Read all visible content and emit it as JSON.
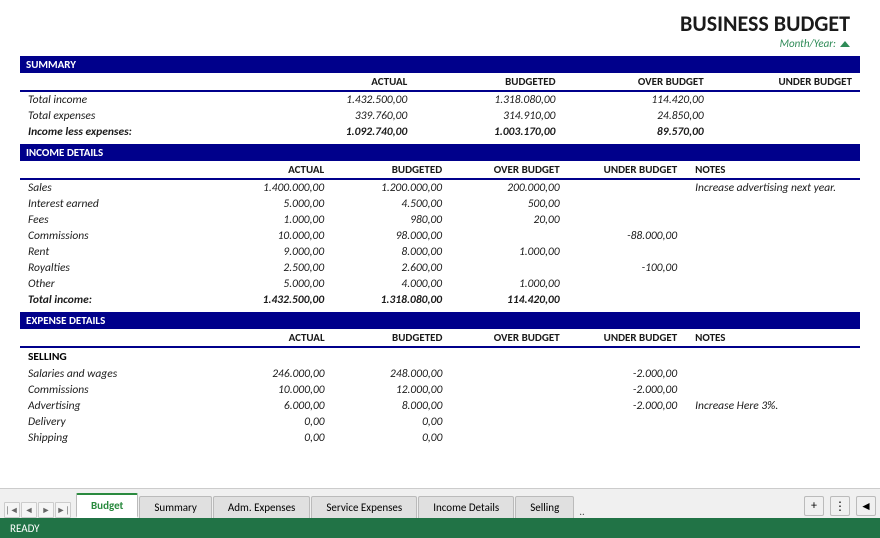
{
  "title": "BUSINESS BUDGET",
  "month_year_label": "Month/Year:",
  "summary": {
    "section_label": "SUMMARY",
    "columns": [
      "",
      "ACTUAL",
      "BUDGETED",
      "OVER BUDGET",
      "UNDER BUDGET"
    ],
    "rows": [
      {
        "label": "Total income",
        "actual": "1.432.500,00",
        "budgeted": "1.318.080,00",
        "over": "114.420,00",
        "under": ""
      },
      {
        "label": "Total expenses",
        "actual": "339.760,00",
        "budgeted": "314.910,00",
        "over": "24.850,00",
        "under": ""
      },
      {
        "label": "Income less expenses:",
        "actual": "1.092.740,00",
        "budgeted": "1.003.170,00",
        "over": "89.570,00",
        "under": "",
        "bold": true
      }
    ]
  },
  "income_details": {
    "section_label": "INCOME DETAILS",
    "columns": [
      "",
      "ACTUAL",
      "BUDGETED",
      "OVER BUDGET",
      "UNDER BUDGET",
      "NOTES"
    ],
    "rows": [
      {
        "label": "Sales",
        "actual": "1.400.000,00",
        "budgeted": "1.200.000,00",
        "over": "200.000,00",
        "under": "",
        "notes": "Increase advertising next year."
      },
      {
        "label": "Interest earned",
        "actual": "5.000,00",
        "budgeted": "4.500,00",
        "over": "500,00",
        "under": "",
        "notes": ""
      },
      {
        "label": "Fees",
        "actual": "1.000,00",
        "budgeted": "980,00",
        "over": "20,00",
        "under": "",
        "notes": ""
      },
      {
        "label": "Commissions",
        "actual": "10.000,00",
        "budgeted": "98.000,00",
        "over": "",
        "under": "-88.000,00",
        "notes": ""
      },
      {
        "label": "Rent",
        "actual": "9.000,00",
        "budgeted": "8.000,00",
        "over": "1.000,00",
        "under": "",
        "notes": ""
      },
      {
        "label": "Royalties",
        "actual": "2.500,00",
        "budgeted": "2.600,00",
        "over": "",
        "under": "-100,00",
        "notes": ""
      },
      {
        "label": "Other",
        "actual": "5.000,00",
        "budgeted": "4.000,00",
        "over": "1.000,00",
        "under": "",
        "notes": ""
      },
      {
        "label": "Total income:",
        "actual": "1.432.500,00",
        "budgeted": "1.318.080,00",
        "over": "114.420,00",
        "under": "",
        "notes": "",
        "bold": true
      }
    ]
  },
  "expense_details": {
    "section_label": "EXPENSE DETAILS",
    "columns": [
      "",
      "ACTUAL",
      "BUDGETED",
      "OVER BUDGET",
      "UNDER BUDGET",
      "NOTES"
    ],
    "selling_label": "SELLING",
    "rows": [
      {
        "label": "Salaries and wages",
        "actual": "246.000,00",
        "budgeted": "248.000,00",
        "over": "",
        "under": "-2.000,00",
        "notes": ""
      },
      {
        "label": "Commissions",
        "actual": "10.000,00",
        "budgeted": "12.000,00",
        "over": "",
        "under": "-2.000,00",
        "notes": ""
      },
      {
        "label": "Advertising",
        "actual": "6.000,00",
        "budgeted": "8.000,00",
        "over": "",
        "under": "-2.000,00",
        "notes": "Increase Here 3%."
      },
      {
        "label": "Delivery",
        "actual": "0,00",
        "budgeted": "0,00",
        "over": "",
        "under": "",
        "notes": ""
      },
      {
        "label": "Shipping",
        "actual": "0,00",
        "budgeted": "0,00",
        "over": "",
        "under": "",
        "notes": ""
      }
    ]
  },
  "tabs": [
    {
      "label": "Budget",
      "active": true
    },
    {
      "label": "Summary",
      "active": false
    },
    {
      "label": "Adm. Expenses",
      "active": false
    },
    {
      "label": "Service Expenses",
      "active": false
    },
    {
      "label": "Income Details",
      "active": false
    },
    {
      "label": "Selling",
      "active": false
    }
  ],
  "status": "READY",
  "tab_ellipsis": "..",
  "add_sheet_label": "+",
  "nav": {
    "prev_label": "◄",
    "next_label": "►",
    "first_label": "|◄",
    "last_label": "►|"
  }
}
